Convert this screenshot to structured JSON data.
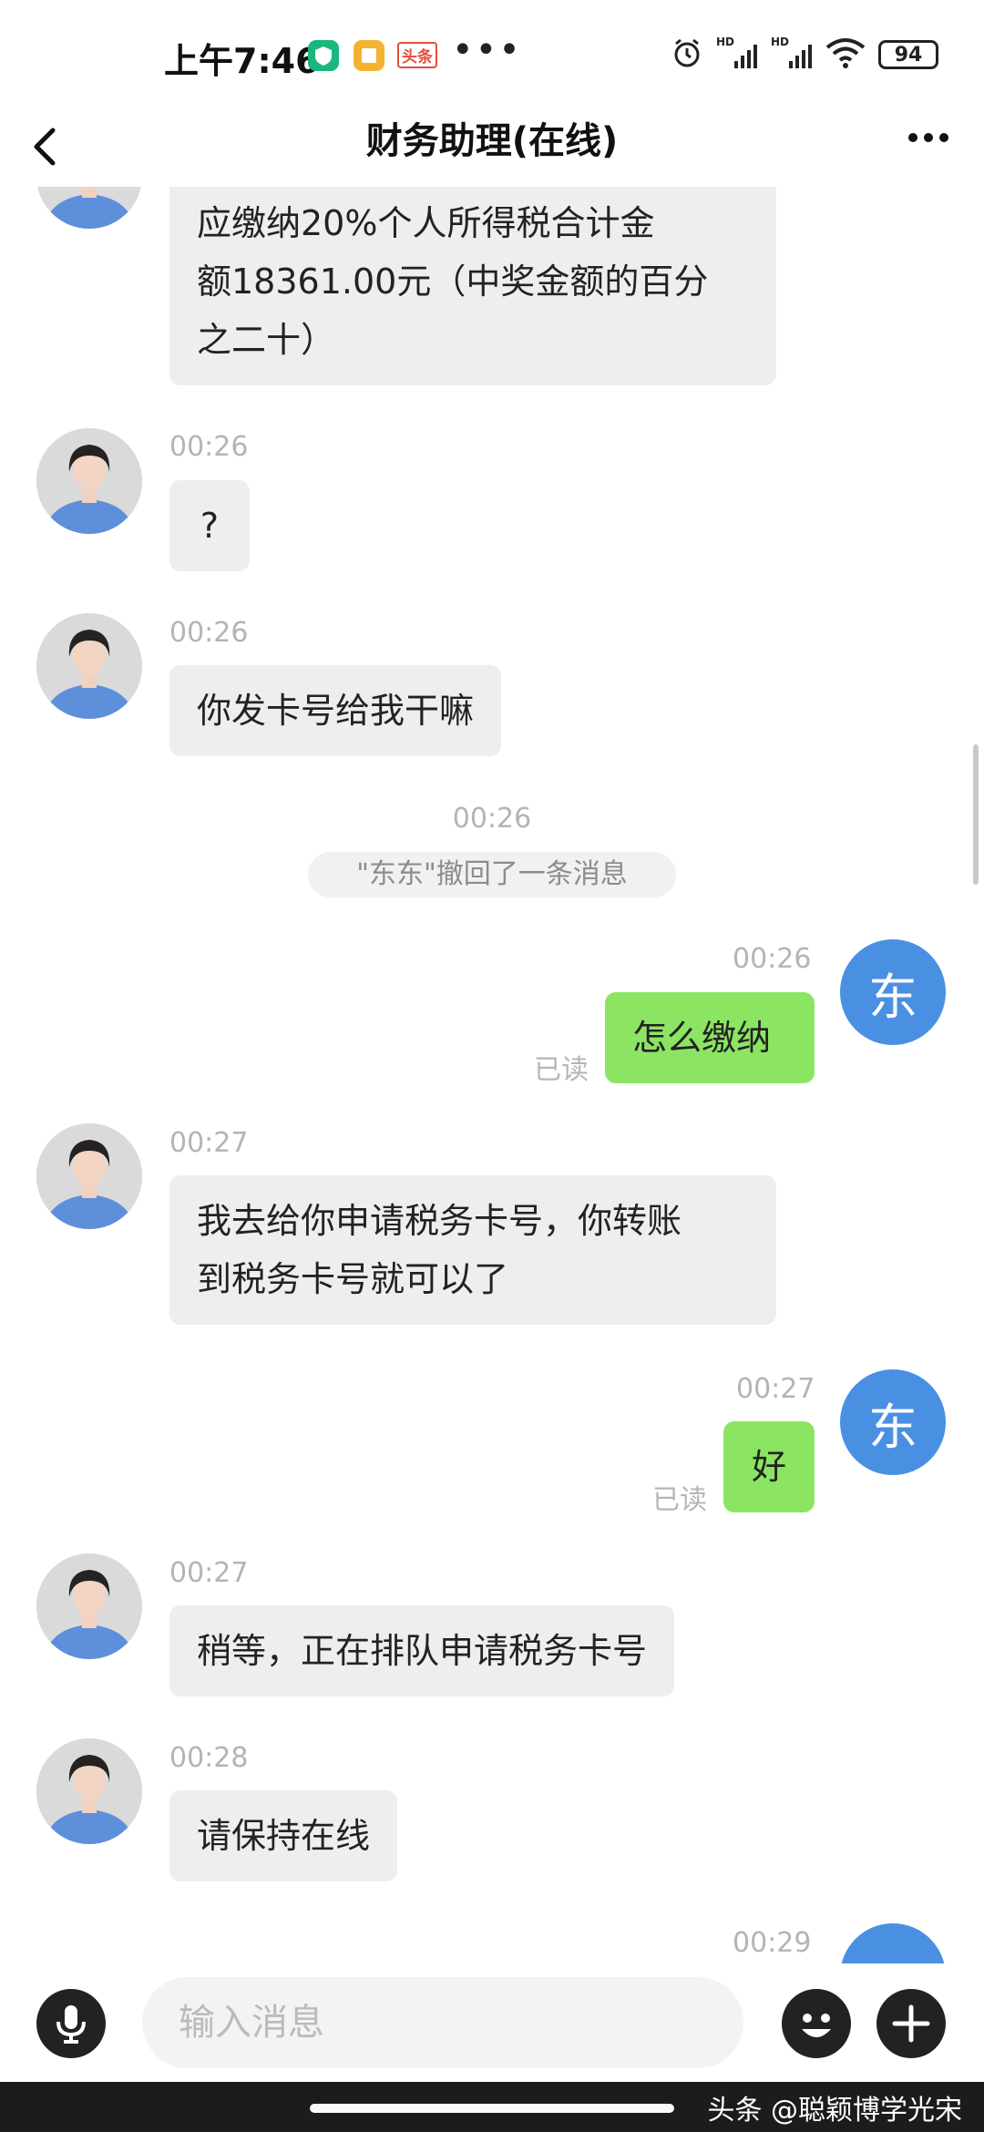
{
  "status_bar": {
    "time": "上午7:46",
    "app_icons": [
      "shield-app-icon",
      "note-app-icon",
      "toutiao-app-icon"
    ],
    "toutiao_label": "头条",
    "more": "•••",
    "battery": "94",
    "icons": [
      "alarm-icon",
      "hd-signal-icon",
      "hd-signal-icon",
      "wifi-icon",
      "battery-icon"
    ],
    "colors": {
      "shield": "#19b77b",
      "note": "#f3b331",
      "toutiao": "#e74c3c"
    }
  },
  "header": {
    "title": "财务助理(在线)"
  },
  "messages": {
    "m1": {
      "text_lines": [
        "应缴纳20%个人所得税合计金",
        "额18361.00元（中奖金额的百分",
        "之二十）"
      ]
    },
    "m2": {
      "time": "00:26",
      "text": "?"
    },
    "m3": {
      "time": "00:26",
      "text": "你发卡号给我干嘛"
    },
    "system": {
      "time": "00:26",
      "text": "\"东东\"撤回了一条消息"
    },
    "m4": {
      "time": "00:26",
      "text": "怎么缴纳",
      "read": "已读",
      "avatar": "东"
    },
    "m5": {
      "time": "00:27",
      "text_lines": [
        "我去给你申请税务卡号，你转账",
        "到税务卡号就可以了"
      ]
    },
    "m6": {
      "time": "00:27",
      "text": "好",
      "read": "已读",
      "avatar": "东"
    },
    "m7": {
      "time": "00:27",
      "text": "稍等，正在排队申请税务卡号"
    },
    "m8": {
      "time": "00:28",
      "text": "请保持在线"
    },
    "m9": {
      "time": "00:29"
    }
  },
  "input_bar": {
    "placeholder": "输入消息"
  },
  "nav": {
    "watermark": "头条 @聪颖博学光宋"
  },
  "colors": {
    "incoming_bubble": "#eeeeee",
    "outgoing_bubble": "#8ce562",
    "my_avatar": "#4a90e2"
  }
}
